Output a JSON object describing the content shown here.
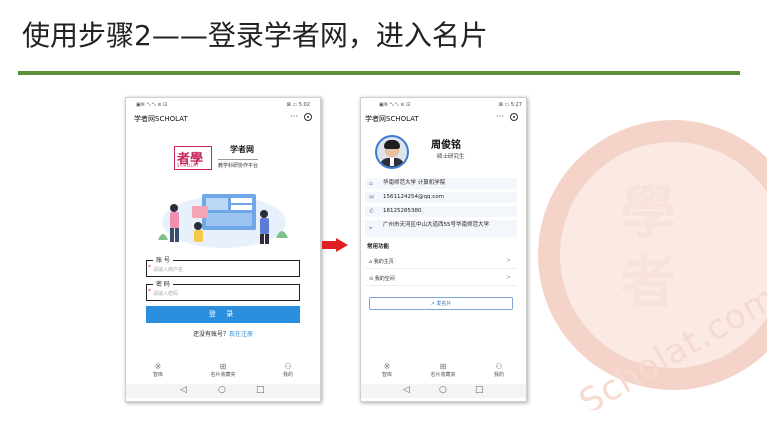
{
  "slide": {
    "title": "使用步骤2——登录学者网，进入名片",
    "accent_color": "#5b8f3a"
  },
  "watermark": {
    "chars": [
      "學",
      "者"
    ],
    "text": "Scholat.com"
  },
  "phone_login": {
    "status_left": "▣⑥ ᵃᵢₗ ᵃᵢₗ ≋ ⊡",
    "status_right": "⊠ ▭ 5:02",
    "app_title": "学者网SCHOLAT",
    "menu_icon": "···",
    "logo_glyph": "者學",
    "logo_sub": "SCHOLAT",
    "logo_name": "学者网",
    "logo_slogan": "教学科研协作平台",
    "account_label": "账 号",
    "account_placeholder": "请输入用户名",
    "password_label": "密 码",
    "password_placeholder": "请输入密码",
    "login_button": "登 录",
    "register_prompt": "还没有账号？",
    "register_link": "现在注册",
    "nav": [
      {
        "icon": "※",
        "label": "智库"
      },
      {
        "icon": "⊞",
        "label": "名片收藏夹"
      },
      {
        "icon": "⚇",
        "label": "我的"
      }
    ],
    "sys_nav": [
      "◁",
      "○",
      "□"
    ]
  },
  "phone_card": {
    "status_left": "▣⑥ ᵃᵢₗ ᵃᵢₗ ≋ ⊡",
    "status_right": "⊠ ▭ 5:27",
    "app_title": "学者网SCHOLAT",
    "menu_icon": "···",
    "name": "周俊铭",
    "degree": "硕士研究生",
    "info": [
      {
        "icon": "⌂",
        "text": "华南师范大学 计算机学院"
      },
      {
        "icon": "✉",
        "text": "1561124254@qq.com"
      },
      {
        "icon": "✆",
        "text": "18125285380"
      },
      {
        "icon": "⌖",
        "text": "广州市天河区中山大道西55号华南师范大学"
      }
    ],
    "section_title": "常用功能",
    "functions": [
      {
        "icon": "⌂",
        "label": "我的主页"
      },
      {
        "icon": "⊙",
        "label": "我的空间"
      }
    ],
    "share_button": "↗ 发名片",
    "nav": [
      {
        "icon": "※",
        "label": "智库"
      },
      {
        "icon": "⊞",
        "label": "名片收藏夹"
      },
      {
        "icon": "⚇",
        "label": "我的"
      }
    ],
    "sys_nav": [
      "◁",
      "○",
      "□"
    ]
  },
  "arrow_color": "#e02020",
  "primary_color": "#2b8fe0"
}
